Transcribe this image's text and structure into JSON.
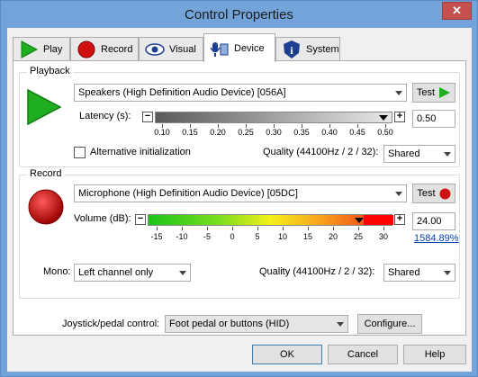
{
  "window": {
    "title": "Control Properties"
  },
  "tabs": [
    {
      "label": "Play"
    },
    {
      "label": "Record"
    },
    {
      "label": "Visual"
    },
    {
      "label": "Device",
      "active": true
    },
    {
      "label": "System"
    }
  ],
  "playback": {
    "group_title": "Playback",
    "device": "Speakers (High Definition Audio Device) [056A]",
    "test_label": "Test",
    "latency_label": "Latency (s):",
    "latency_value": "0.50",
    "latency_fraction": 0.96,
    "latency_ticks": [
      "0.10",
      "0.15",
      "0.20",
      "0.25",
      "0.30",
      "0.35",
      "0.40",
      "0.45",
      "0.50"
    ],
    "alt_init_label": "Alternative initialization",
    "alt_init_checked": false,
    "quality_label": "Quality (44100Hz / 2 / 32):",
    "quality_value": "Shared"
  },
  "record": {
    "group_title": "Record",
    "device": "Microphone (High Definition Audio Device) [05DC]",
    "test_label": "Test",
    "volume_label": "Volume (dB):",
    "volume_value": "24.00",
    "volume_percent": "1584.89%",
    "volume_fraction": 0.86,
    "volume_ticks": [
      "-15",
      "-10",
      "-5",
      "0",
      "5",
      "10",
      "15",
      "20",
      "25",
      "30"
    ],
    "mono_label": "Mono:",
    "mono_value": "Left channel only",
    "quality_label": "Quality (44100Hz / 2 / 32):",
    "quality_value": "Shared"
  },
  "joystick": {
    "label": "Joystick/pedal control:",
    "value": "Foot pedal or buttons (HID)",
    "configure_label": "Configure..."
  },
  "buttons": {
    "ok": "OK",
    "cancel": "Cancel",
    "help": "Help"
  },
  "colors": {
    "play_green": "#1fae1f",
    "record_red": "#d01010",
    "titlebar": "#73a4d9",
    "close_red": "#c74f4f"
  }
}
